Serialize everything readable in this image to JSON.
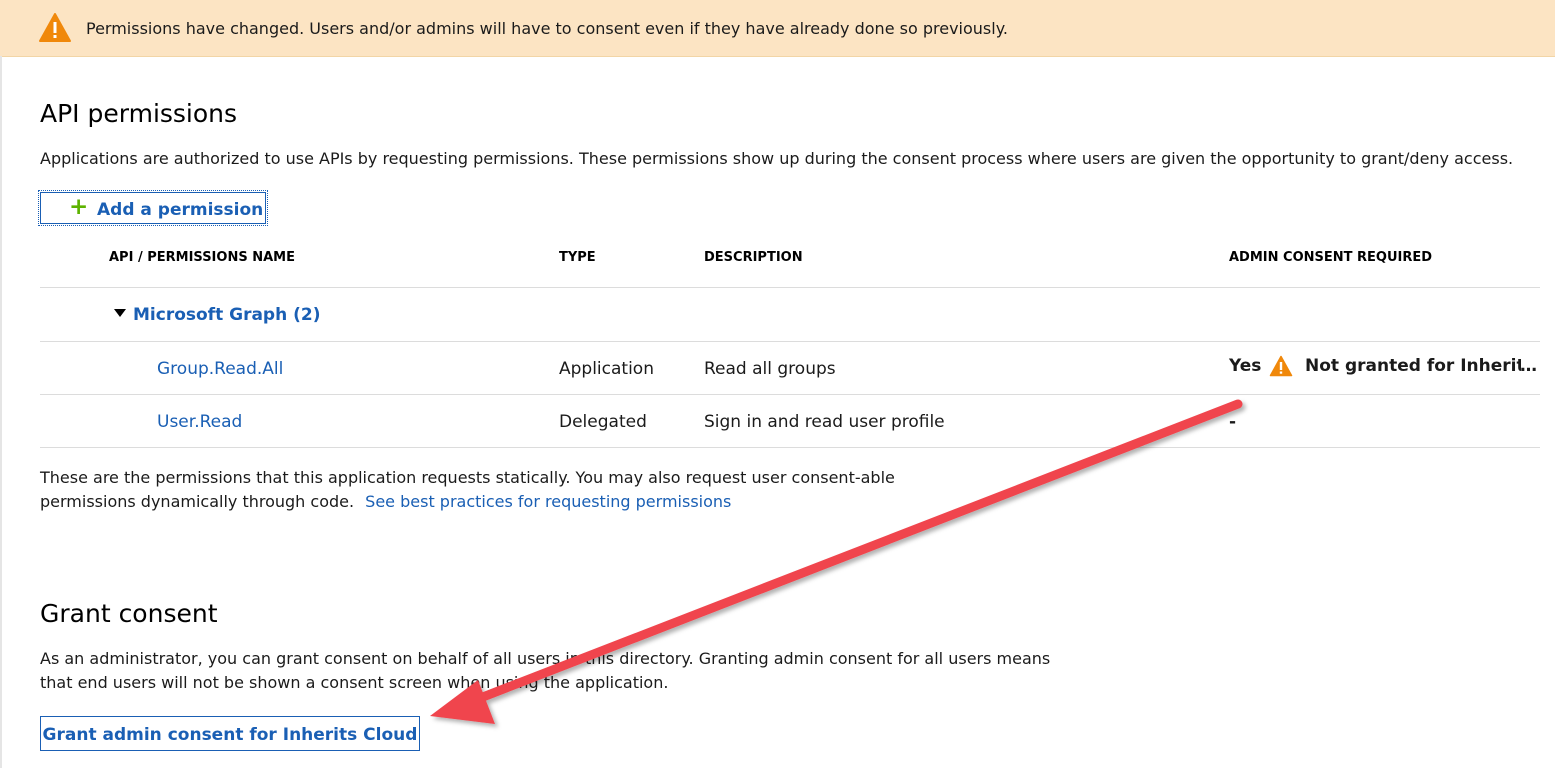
{
  "banner": {
    "text": "Permissions have changed. Users and/or admins will have to consent even if they have already done so previously."
  },
  "api_permissions": {
    "title": "API permissions",
    "description": "Applications are authorized to use APIs by requesting permissions. These permissions show up during the consent process where users are given the opportunity to grant/deny access.",
    "add_button_label": "Add a permission",
    "columns": [
      "API / PERMISSIONS NAME",
      "TYPE",
      "DESCRIPTION",
      "ADMIN CONSENT REQUIRED"
    ],
    "group": {
      "label": "Microsoft Graph (2)"
    },
    "rows": [
      {
        "name": "Group.Read.All",
        "type": "Application",
        "description": "Read all groups",
        "admin_consent": "Yes",
        "status": "Not granted for Inherits Cloud"
      },
      {
        "name": "User.Read",
        "type": "Delegated",
        "description": "Sign in and read user profile",
        "admin_consent": "-"
      }
    ],
    "footnote_line1": "These are the permissions that this application requests statically. You may also request user consent-able",
    "footnote_line2": "permissions dynamically through code.",
    "footnote_link": "See best practices for requesting permissions"
  },
  "grant_consent": {
    "title": "Grant consent",
    "description_line1": "As an administrator, you can grant consent on behalf of all users in this directory. Granting admin consent for all users means",
    "description_line2": "that end users will not be shown a consent screen when using the application.",
    "button_label": "Grant admin consent for Inherits Cloud"
  },
  "icons": {
    "warning": "warning-icon",
    "add": "plus-icon",
    "expand": "caret-down-icon"
  },
  "colors": {
    "banner_bg": "#fce4c3",
    "warning": "#f0880a",
    "link": "#1a5fb4",
    "plus": "#5db300",
    "annotation_arrow": "#f0454d"
  }
}
